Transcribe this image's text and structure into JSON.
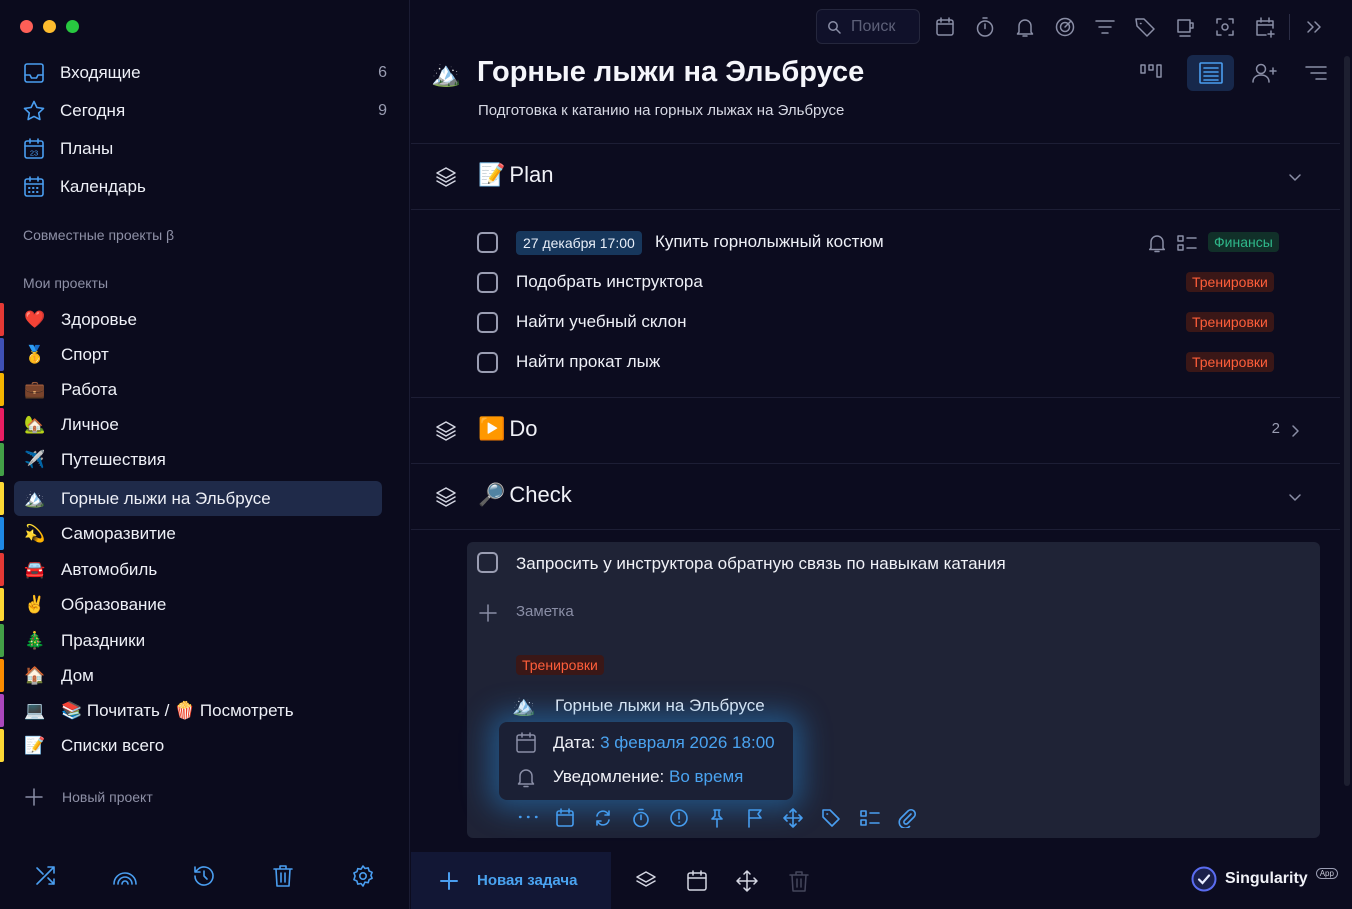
{
  "sidebar": {
    "nav": [
      {
        "label": "Входящие",
        "count": "6",
        "icon": "inbox-icon"
      },
      {
        "label": "Сегодня",
        "count": "9",
        "icon": "star-icon"
      },
      {
        "label": "Планы",
        "count": "",
        "icon": "calendar-23-icon"
      },
      {
        "label": "Календарь",
        "count": "",
        "icon": "calendar-grid-icon"
      }
    ],
    "shared_projects": "Совместные проекты β",
    "my_projects": "Мои проекты",
    "projects": [
      {
        "label": "Здоровье",
        "emoji": "❤️",
        "color": "#e53935"
      },
      {
        "label": "Спорт",
        "emoji": "🥇",
        "color": "#3f51b5"
      },
      {
        "label": "Работа",
        "emoji": "💼",
        "color": "#f4b400"
      },
      {
        "label": "Личное",
        "emoji": "🏡",
        "color": "#e91e63"
      },
      {
        "label": "Путешествия",
        "emoji": "✈️",
        "color": "#43a047"
      },
      {
        "label": "Горные лыжи на Эльбрусе",
        "emoji": "🏔️",
        "color": "#fdd835"
      },
      {
        "label": "Саморазвитие",
        "emoji": "💫",
        "color": "#1e88e5"
      },
      {
        "label": "Автомобиль",
        "emoji": "🚘",
        "color": "#e53935"
      },
      {
        "label": "Образование",
        "emoji": "✌️",
        "color": "#fdd835"
      },
      {
        "label": "Праздники",
        "emoji": "🎄",
        "color": "#43a047"
      },
      {
        "label": "Дом",
        "emoji": "🏠",
        "color": "#fb8c00"
      },
      {
        "label": "📚 Почитать / 🍿 Посмотреть",
        "emoji": "💻",
        "color": "#ab47bc"
      },
      {
        "label": "Списки всего",
        "emoji": "📝",
        "color": "#fdd835"
      }
    ],
    "new_project": "Новый проект"
  },
  "toolbar": {
    "search_placeholder": "Поиск"
  },
  "project": {
    "emoji": "🏔️",
    "title": "Горные лыжи на Эльбрусе",
    "subtitle": "Подготовка к катанию на горных лыжах на Эльбрусе"
  },
  "sections": [
    {
      "emoji": "📝",
      "name": "Plan"
    },
    {
      "emoji": "▶️",
      "name": "Do",
      "count": "2"
    },
    {
      "emoji": "🔎",
      "name": "Check"
    }
  ],
  "plan_tasks": [
    {
      "date": "27 декабря 17:00",
      "text": "Купить горнолыжный костюм",
      "tag": "Финансы"
    },
    {
      "text": "Подобрать инструктора",
      "tag": "Тренировки"
    },
    {
      "text": "Найти учебный склон",
      "tag": "Тренировки"
    },
    {
      "text": "Найти прокат лыж",
      "tag": "Тренировки"
    }
  ],
  "detail": {
    "task": "Запросить у инструктора обратную связь по навыкам катания",
    "note_placeholder": "Заметка",
    "tag": "Тренировки",
    "project": "Горные лыжи на Эльбрусе",
    "date_label": "Дата:",
    "date_value": "3 февраля 2026 18:00",
    "notify_label": "Уведомление:",
    "notify_value": "Во время"
  },
  "bottom": {
    "new_task": "Новая задача",
    "brand": "Singularity",
    "brand_badge": "App"
  },
  "colors": {
    "accent": "#4aa3f0",
    "tag_red": "#ff5e3a",
    "tag_green": "#2fb88a"
  }
}
